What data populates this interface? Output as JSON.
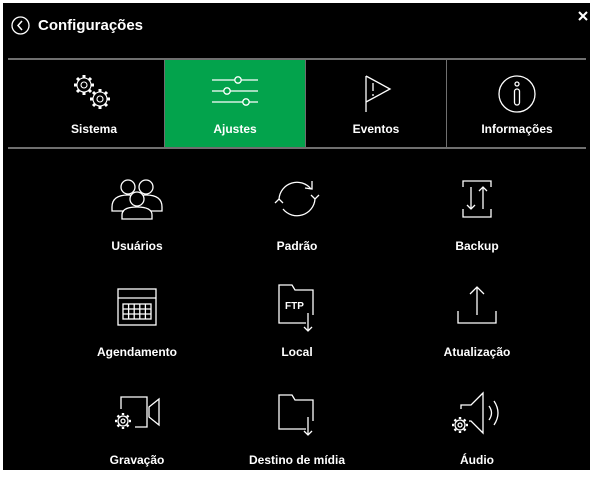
{
  "header": {
    "title": "Configurações"
  },
  "tabs": [
    {
      "label": "Sistema",
      "icon": "gears-icon",
      "active": false
    },
    {
      "label": "Ajustes",
      "icon": "sliders-icon",
      "active": true
    },
    {
      "label": "Eventos",
      "icon": "warning-flag-icon",
      "active": false
    },
    {
      "label": "Informações",
      "icon": "info-icon",
      "active": false
    }
  ],
  "items": [
    {
      "label": "Usuários",
      "icon": "users-icon"
    },
    {
      "label": "Padrão",
      "icon": "refresh-icon"
    },
    {
      "label": "Backup",
      "icon": "backup-icon"
    },
    {
      "label": "Agendamento",
      "icon": "schedule-icon"
    },
    {
      "label": "Local",
      "icon": "ftp-folder-icon",
      "icon_text": "FTP"
    },
    {
      "label": "Atualização",
      "icon": "upload-icon"
    },
    {
      "label": "Gravação",
      "icon": "record-camera-icon"
    },
    {
      "label": "Destino de mídia",
      "icon": "media-folder-icon"
    },
    {
      "label": "Áudio",
      "icon": "audio-icon"
    }
  ],
  "colors": {
    "background": "#000000",
    "active_tab": "#03a34c",
    "divider": "#6f6f6f",
    "text": "#ffffff"
  }
}
